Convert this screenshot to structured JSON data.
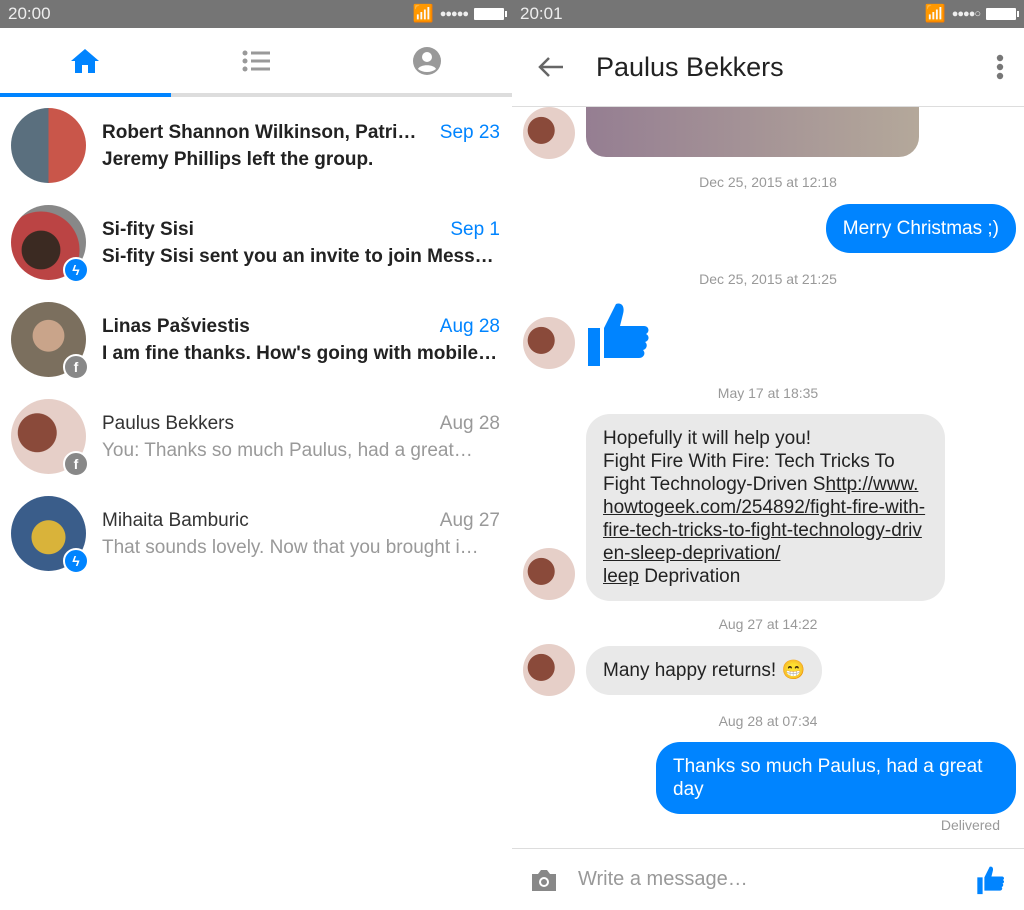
{
  "left": {
    "status_time": "20:00",
    "tabs": [
      {
        "icon": "home-icon"
      },
      {
        "icon": "list-icon"
      },
      {
        "icon": "profile-icon"
      }
    ],
    "conversations": [
      {
        "name": "Robert Shannon Wilkinson, Patrick…",
        "preview": "Jeremy Phillips left the group.",
        "date": "Sep 23",
        "unread": true,
        "badge": ""
      },
      {
        "name": "Si-fity Sisi",
        "preview": "Si-fity Sisi sent you an invite to join Mess…",
        "date": "Sep 1",
        "unread": true,
        "badge": "messenger"
      },
      {
        "name": "Linas Pašviestis",
        "preview": "I am fine thanks. How's going with mobile…",
        "date": "Aug 28",
        "unread": true,
        "badge": "facebook"
      },
      {
        "name": "Paulus Bekkers",
        "preview": "You: Thanks so much Paulus, had a great…",
        "date": "Aug 28",
        "unread": false,
        "badge": "facebook"
      },
      {
        "name": "Mihaita Bamburic",
        "preview": "That sounds lovely. Now that you brought i…",
        "date": "Aug 27",
        "unread": false,
        "badge": "messenger"
      }
    ]
  },
  "right": {
    "status_time": "20:01",
    "title": "Paulus Bekkers",
    "timestamps": [
      "Dec 25, 2015 at 12:18",
      "Dec 25, 2015 at 21:25",
      "May 17 at 18:35",
      "Aug 27 at 14:22",
      "Aug 28 at 07:34"
    ],
    "msg_christmas": "Merry Christmas ;)",
    "msg_help_l1": "Hopefully it will help you!",
    "msg_help_l2": "Fight Fire With Fire: Tech Tricks To Fight Technology-Driven S",
    "msg_help_link": "http://www.howtogeek.com/254892/fight-fire-with-fire-tech-tricks-to-fight-technology-driven-sleep-deprivation/",
    "msg_help_link2": "leep",
    "msg_help_tail": " Deprivation",
    "msg_returns": "Many happy returns! 😁",
    "msg_thanks": "Thanks so much Paulus, had a great day",
    "delivered": "Delivered",
    "composer_placeholder": "Write a message…"
  },
  "colors": {
    "accent": "#0084ff",
    "status_bar": "#757575"
  }
}
